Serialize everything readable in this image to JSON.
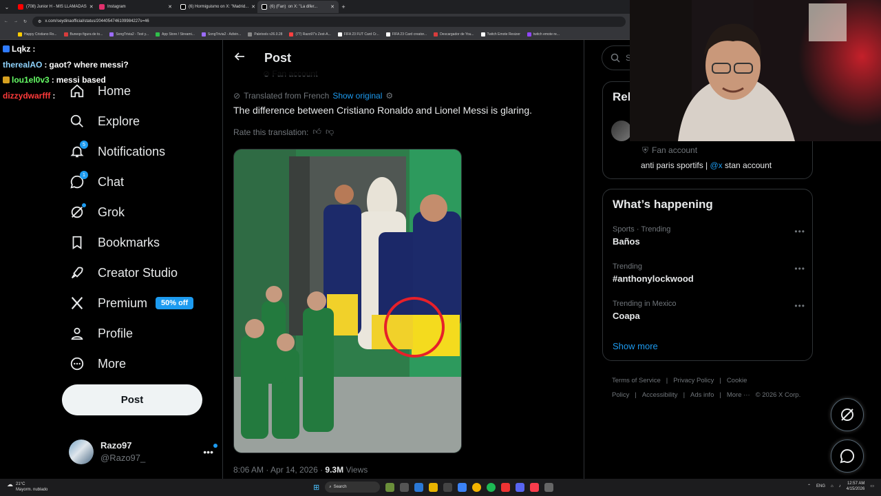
{
  "browser": {
    "tabs": [
      {
        "title": "(708) Junior H - MIS LLAMADAS",
        "color": "#ff0000",
        "active": false
      },
      {
        "title": "Instagram",
        "color": "#e1306c",
        "active": false
      },
      {
        "title": "(6) Hormiguismo on X: \"Madrid...",
        "color": "#ffffff",
        "active": false
      },
      {
        "title": "(6) (Fan) ⁣⁣ on X: \"La difer...",
        "color": "#ffffff",
        "active": true
      }
    ],
    "url": "x.com/seydinaofficial/status/2044054746109984227s=46",
    "bookmarks": [
      {
        "label": "Happy Cristiano Ro...",
        "color": "#ffcc00"
      },
      {
        "label": "Buneqo figura de to...",
        "color": "#d83c3c"
      },
      {
        "label": "SongTrivia2 - Test y...",
        "color": "#9c6cff"
      },
      {
        "label": "App Store / Streami...",
        "color": "#2fbf4a"
      },
      {
        "label": "SongTrivia2 - Adivin...",
        "color": "#9c6cff"
      },
      {
        "label": "Paletools v26.0.28",
        "color": "#888888"
      },
      {
        "label": "(77) Razo97's Zest-A...",
        "color": "#ff4040"
      },
      {
        "label": "FIFA 23 FUT Card Cr...",
        "color": "#ffffff"
      },
      {
        "label": "FIFA 23 Card creator...",
        "color": "#ffffff"
      },
      {
        "label": "Descargador de You...",
        "color": "#d83c3c"
      },
      {
        "label": "Twitch Emote Resizer",
        "color": "#ffffff"
      },
      {
        "label": "twitch emote re...",
        "color": "#9146ff"
      }
    ]
  },
  "chat": [
    {
      "user": "Lqkz",
      "msg": "",
      "color": "#ffffff",
      "badge": "#2f7bff"
    },
    {
      "user": "therealAO",
      "msg": "gaot? where messi?",
      "color": "#8fd4ff",
      "badge": ""
    },
    {
      "user": "lou1el0v3",
      "msg": "messi based",
      "color": "#66ff66",
      "badge": "#d6a020"
    },
    {
      "user": "dizzydwarfff",
      "msg": "",
      "color": "#ff3a3a",
      "badge": ""
    }
  ],
  "nav": {
    "items": [
      {
        "label": "Home",
        "icon": "home-icon",
        "badge": ""
      },
      {
        "label": "Explore",
        "icon": "search-icon",
        "badge": ""
      },
      {
        "label": "Notifications",
        "icon": "bell-icon",
        "badge": "5"
      },
      {
        "label": "Chat",
        "icon": "chat-icon",
        "badge": "1"
      },
      {
        "label": "Grok",
        "icon": "grok-icon",
        "badge": "dot"
      },
      {
        "label": "Bookmarks",
        "icon": "bookmark-icon",
        "badge": ""
      },
      {
        "label": "Creator Studio",
        "icon": "rocket-icon",
        "badge": ""
      },
      {
        "label": "Premium",
        "icon": "x-logo-icon",
        "badge": ""
      },
      {
        "label": "Profile",
        "icon": "person-icon",
        "badge": ""
      },
      {
        "label": "More",
        "icon": "more-circle-icon",
        "badge": ""
      }
    ],
    "premium_promo": "50% off",
    "post_button": "Post"
  },
  "account": {
    "name": "Razo97",
    "handle": "@Razo97_"
  },
  "post": {
    "header_title": "Post",
    "author_label_partial": "Fan account",
    "translated_from": "Translated from French",
    "show_original": "Show original",
    "text": "The difference between Cristiano Ronaldo and Lionel Messi is glaring.",
    "rate_label": "Rate this translation:",
    "timestamp": "8:06 AM · Apr 14, 2026 ·",
    "views_count": "9.3M",
    "views_label": "Views"
  },
  "sidebar": {
    "search_placeholder": "Se",
    "relevant_title": "Rel",
    "fan_account_label": "Fan account",
    "bio_prefix": "anti paris sportifs |",
    "bio_mention": "@x",
    "bio_suffix": "stan account",
    "happening_title": "What’s happening",
    "trends": [
      {
        "category": "Sports · Trending",
        "name": "Baños"
      },
      {
        "category": "Trending",
        "name": "#anthonylockwood"
      },
      {
        "category": "Trending in Mexico",
        "name": "Coapa"
      }
    ],
    "show_more": "Show more",
    "footer_links": [
      "Terms of Service",
      "|",
      "Privacy Policy",
      "|",
      "Cookie Policy",
      "|",
      "Accessibility",
      "|",
      "Ads info",
      "|",
      "More ···",
      "© 2026 X Corp."
    ]
  },
  "taskbar": {
    "weather_temp": "21°C",
    "weather_desc": "Mayorm. nublado",
    "search_label": "Search",
    "lang": "ENG",
    "time": "12:57 AM",
    "date": "4/15/2026"
  },
  "colors": {
    "accent": "#1d9bf0",
    "border": "#2f3336",
    "muted": "#71767b",
    "text": "#e7e9ea"
  }
}
